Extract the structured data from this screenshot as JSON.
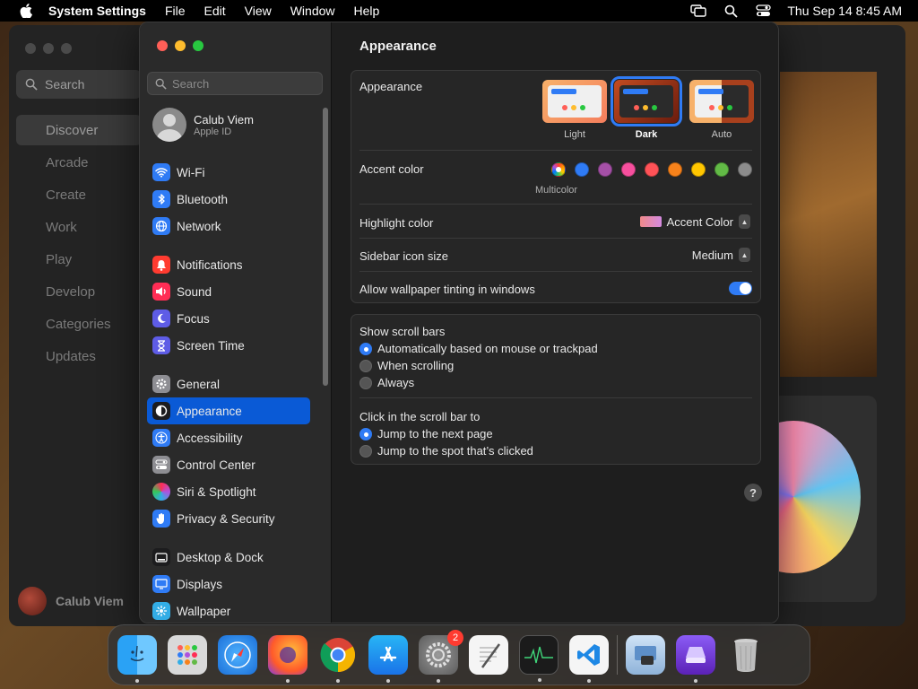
{
  "menubar": {
    "app_name": "System Settings",
    "menus": [
      "File",
      "Edit",
      "View",
      "Window",
      "Help"
    ],
    "clock": "Thu Sep 14  8:45 AM"
  },
  "background_app": {
    "search_placeholder": "Search",
    "nav": [
      "Discover",
      "Arcade",
      "Create",
      "Work",
      "Play",
      "Develop",
      "Categories",
      "Updates"
    ],
    "user_name": "Calub Viem"
  },
  "settings": {
    "search_placeholder": "Search",
    "profile": {
      "name": "Calub Viem",
      "subtitle": "Apple ID"
    },
    "sidebar_groups": [
      [
        {
          "label": "Wi-Fi",
          "icon": "wifi-icon",
          "color": "#2f7bf5"
        },
        {
          "label": "Bluetooth",
          "icon": "bluetooth-icon",
          "color": "#2f7bf5"
        },
        {
          "label": "Network",
          "icon": "globe-icon",
          "color": "#2f7bf5"
        }
      ],
      [
        {
          "label": "Notifications",
          "icon": "bell-icon",
          "color": "#ff3b30"
        },
        {
          "label": "Sound",
          "icon": "speaker-icon",
          "color": "#ff2d55"
        },
        {
          "label": "Focus",
          "icon": "moon-icon",
          "color": "#5e5ce6"
        },
        {
          "label": "Screen Time",
          "icon": "hourglass-icon",
          "color": "#5e5ce6"
        }
      ],
      [
        {
          "label": "General",
          "icon": "gear-icon",
          "color": "#8e8e93"
        },
        {
          "label": "Appearance",
          "icon": "appearance-icon",
          "color": "#1c1c1e",
          "selected": true
        },
        {
          "label": "Accessibility",
          "icon": "accessibility-icon",
          "color": "#2f7bf5"
        },
        {
          "label": "Control Center",
          "icon": "control-center-icon",
          "color": "#8e8e93"
        },
        {
          "label": "Siri & Spotlight",
          "icon": "siri-icon",
          "color": "#af52de"
        },
        {
          "label": "Privacy & Security",
          "icon": "hand-icon",
          "color": "#2f7bf5"
        }
      ],
      [
        {
          "label": "Desktop & Dock",
          "icon": "dock-icon",
          "color": "#1c1c1e"
        },
        {
          "label": "Displays",
          "icon": "display-icon",
          "color": "#2f7bf5"
        },
        {
          "label": "Wallpaper",
          "icon": "wallpaper-icon",
          "color": "#32ade6"
        }
      ]
    ],
    "content": {
      "title": "Appearance",
      "appearance_label": "Appearance",
      "modes": [
        {
          "label": "Light"
        },
        {
          "label": "Dark",
          "selected": true
        },
        {
          "label": "Auto"
        }
      ],
      "accent_label": "Accent color",
      "accent_colors": [
        "multicolor",
        "#2f7bf5",
        "#a550a7",
        "#f74f9e",
        "#ff5257",
        "#f7821b",
        "#ffc600",
        "#62ba46",
        "#8c8c8c"
      ],
      "accent_selected_label": "Multicolor",
      "highlight_label": "Highlight color",
      "highlight_value": "Accent Color",
      "sidebar_icon_label": "Sidebar icon size",
      "sidebar_icon_value": "Medium",
      "tinting_label": "Allow wallpaper tinting in windows",
      "tinting_on": true,
      "scroll_bars_label": "Show scroll bars",
      "scroll_bar_options": [
        "Automatically based on mouse or trackpad",
        "When scrolling",
        "Always"
      ],
      "scroll_bar_selected": 0,
      "click_label": "Click in the scroll bar to",
      "click_options": [
        "Jump to the next page",
        "Jump to the spot that’s clicked"
      ],
      "click_selected": 0,
      "help": "?"
    }
  },
  "dock": {
    "apps": [
      "Finder",
      "Launchpad",
      "Safari",
      "Firefox",
      "Chrome",
      "App Store",
      "System Settings",
      "TextEdit",
      "Activity Monitor",
      "Visual Studio Code"
    ],
    "settings_badge": "2"
  }
}
